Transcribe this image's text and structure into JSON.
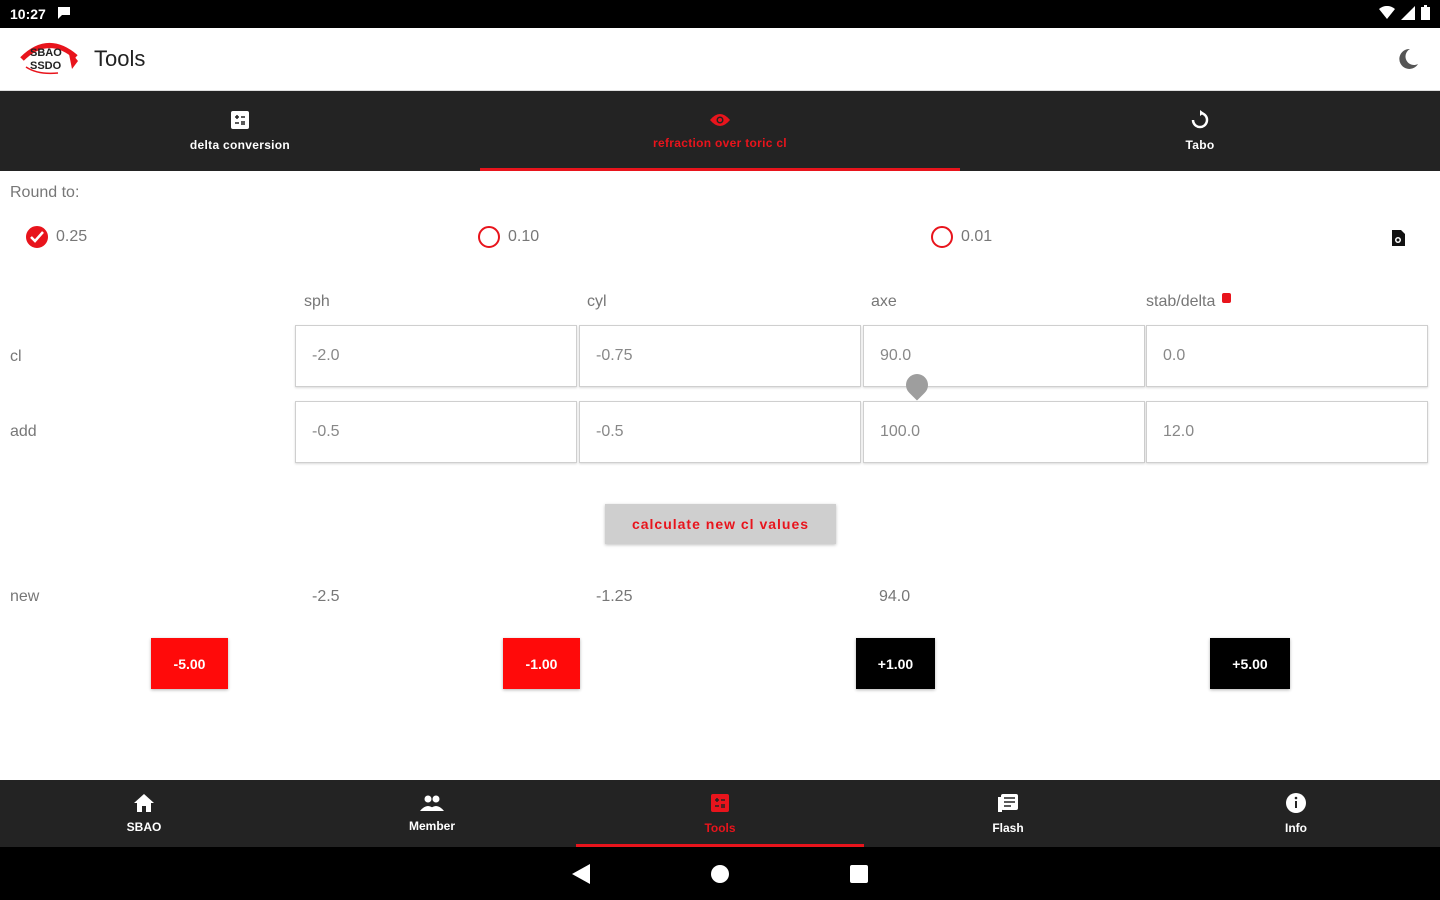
{
  "status": {
    "time": "10:27"
  },
  "app": {
    "title": "Tools",
    "logo_text_top": "SBAO",
    "logo_text_bottom": "SSDO"
  },
  "top_tabs": [
    {
      "label": "delta conversion",
      "icon": "calculator-icon"
    },
    {
      "label": "refraction over toric cl",
      "icon": "eye-icon"
    },
    {
      "label": "Tabo",
      "icon": "refresh-icon"
    }
  ],
  "round": {
    "label": "Round to:",
    "options": [
      "0.25",
      "0.10",
      "0.01"
    ],
    "selected": "0.25"
  },
  "columns": {
    "sph": "sph",
    "cyl": "cyl",
    "axe": "axe",
    "stab": "stab/delta"
  },
  "rows": {
    "cl": {
      "label": "cl",
      "sph": "-2.0",
      "cyl": "-0.75",
      "axe": "90.0",
      "stab": "0.0"
    },
    "add": {
      "label": "add",
      "sph": "-0.5",
      "cyl": "-0.5",
      "axe": "100.0",
      "stab": "12.0"
    }
  },
  "calculate_label": "calculate new cl values",
  "result": {
    "label": "new",
    "sph": "-2.5",
    "cyl": "-1.25",
    "axe": "94.0"
  },
  "steps": [
    "-5.00",
    "-1.00",
    "+1.00",
    "+5.00"
  ],
  "bottom_nav": [
    {
      "label": "SBAO",
      "icon": "home-icon"
    },
    {
      "label": "Member",
      "icon": "group-icon"
    },
    {
      "label": "Tools",
      "icon": "calculator-icon"
    },
    {
      "label": "Flash",
      "icon": "news-icon"
    },
    {
      "label": "Info",
      "icon": "info-icon"
    }
  ],
  "colors": {
    "accent": "#e8141c",
    "bar": "#232323"
  }
}
